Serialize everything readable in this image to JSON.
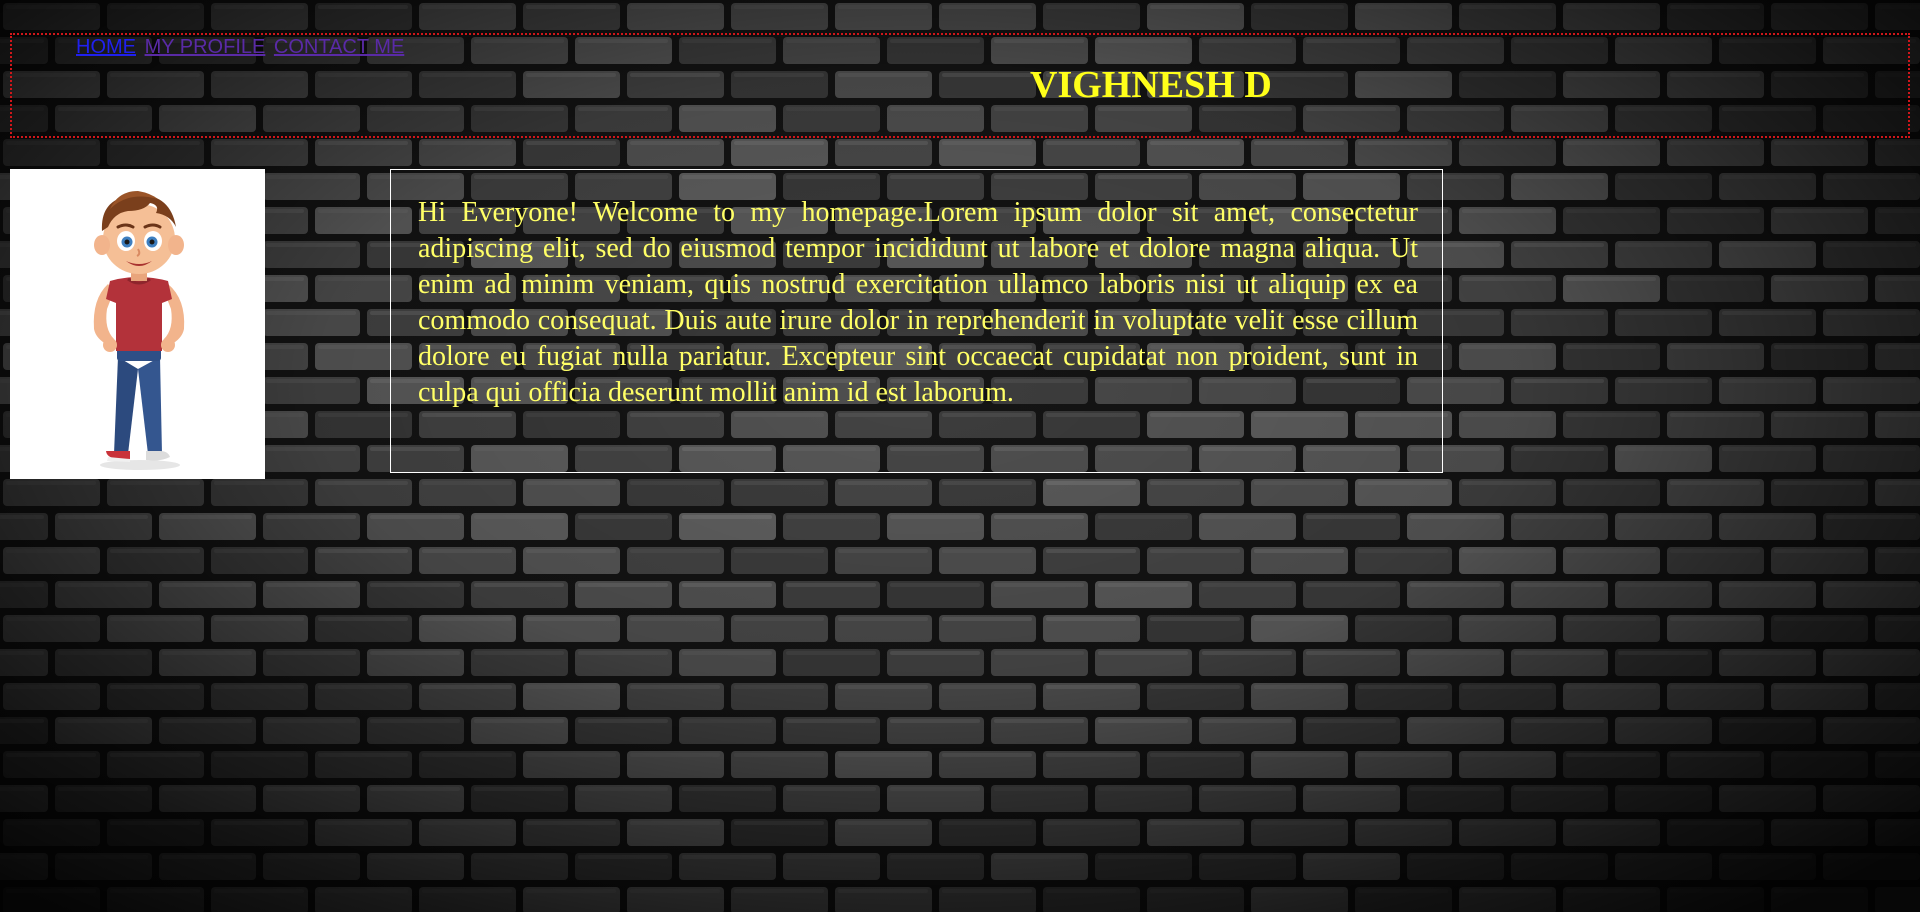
{
  "nav": {
    "items": [
      {
        "label": "HOME"
      },
      {
        "label": "MY PROFILE"
      },
      {
        "label": "CONTACT ME"
      }
    ]
  },
  "header": {
    "title": "VIGHNESH D"
  },
  "main": {
    "intro": "Hi Everyone! Welcome to my homepage.Lorem ipsum dolor sit amet, consectetur adipiscing elit, sed do eiusmod tempor incididunt ut labore et dolore magna aliqua. Ut enim ad minim veniam, quis nostrud exercitation ullamco laboris nisi ut aliquip ex ea commodo consequat. Duis aute irure dolor in reprehenderit in voluptate velit esse cillum dolore eu fugiat nulla pariatur. Excepteur sint occaecat cupidatat non proident, sunt in culpa qui officia deserunt mollit anim id est laborum."
  },
  "colors": {
    "title": "#ffff1a",
    "intro_text": "#ffff66",
    "header_border": "#d0161a",
    "link": "#2020ee",
    "link_visited": "#5a2aa6",
    "background": "#2e2e2e"
  },
  "images": {
    "avatar": "cartoon-boy-avatar",
    "background": "brick-wall-texture"
  }
}
